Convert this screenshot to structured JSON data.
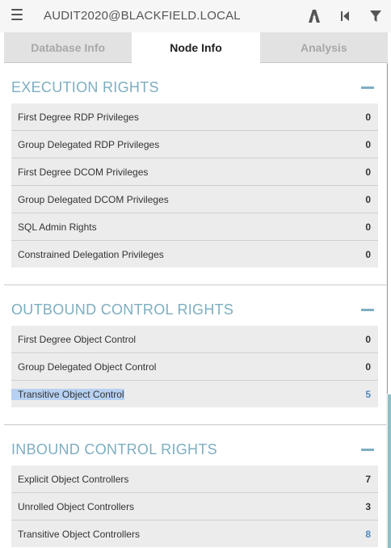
{
  "header": {
    "node_name": "AUDIT2020@BLACKFIELD.LOCAL"
  },
  "tabs": [
    {
      "label": "Database Info",
      "active": false
    },
    {
      "label": "Node Info",
      "active": true
    },
    {
      "label": "Analysis",
      "active": false
    }
  ],
  "sections": [
    {
      "title": "EXECUTION RIGHTS",
      "rows": [
        {
          "label": "First Degree RDP Privileges",
          "value": "0"
        },
        {
          "label": "Group Delegated RDP Privileges",
          "value": "0"
        },
        {
          "label": "First Degree DCOM Privileges",
          "value": "0"
        },
        {
          "label": "Group Delegated DCOM Privileges",
          "value": "0"
        },
        {
          "label": "SQL Admin Rights",
          "value": "0"
        },
        {
          "label": "Constrained Delegation Privileges",
          "value": "0"
        }
      ]
    },
    {
      "title": "OUTBOUND CONTROL RIGHTS",
      "rows": [
        {
          "label": "First Degree Object Control",
          "value": "0"
        },
        {
          "label": "Group Delegated Object Control",
          "value": "0"
        },
        {
          "label": "Transitive Object Control",
          "value": "5"
        }
      ]
    },
    {
      "title": "INBOUND CONTROL RIGHTS",
      "rows": [
        {
          "label": "Explicit Object Controllers",
          "value": "7"
        },
        {
          "label": "Unrolled Object Controllers",
          "value": "3"
        },
        {
          "label": "Transitive Object Controllers",
          "value": "8"
        }
      ]
    }
  ],
  "colors": {
    "section_title": "#7eaec0",
    "link_value": "#4e88c0",
    "selection": "#b7d1f2"
  }
}
